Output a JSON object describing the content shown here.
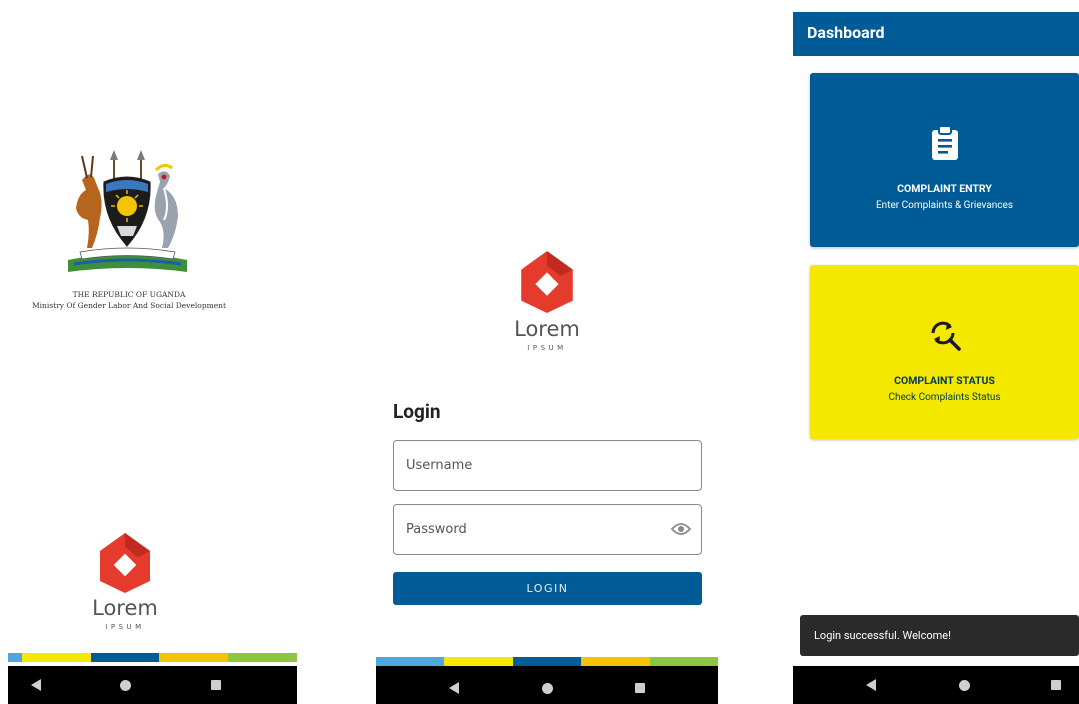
{
  "colors": {
    "primary": "#005b96",
    "accent_yellow": "#f5e800",
    "stripe": [
      "#4fa8dc",
      "#f5e800",
      "#005b96",
      "#f5c400",
      "#8cc63f"
    ]
  },
  "splash": {
    "coat_of_arms_icon": "uganda-coat-of-arms",
    "caption_line1": "THE REPUBLIC OF UGANDA",
    "caption_line2": "Ministry Of Gender Labor And Social Development",
    "logo": {
      "word": "Lorem",
      "tagline": "IPSUM"
    }
  },
  "login": {
    "logo": {
      "word": "Lorem",
      "tagline": "IPSUM"
    },
    "title": "Login",
    "username_placeholder": "Username",
    "password_placeholder": "Password",
    "password_toggle_icon": "eye-icon",
    "submit_label": "LOGIN"
  },
  "dashboard": {
    "title": "Dashboard",
    "cards": [
      {
        "icon": "clipboard-icon",
        "title": "COMPLAINT ENTRY",
        "subtitle": "Enter Complaints & Grievances"
      },
      {
        "icon": "search-refresh-icon",
        "title": "COMPLAINT STATUS",
        "subtitle": "Check Complaints Status"
      }
    ],
    "snackbar": "Login successful. Welcome!"
  },
  "navigation": {
    "icons": [
      "back-icon",
      "home-icon",
      "recents-icon"
    ]
  }
}
